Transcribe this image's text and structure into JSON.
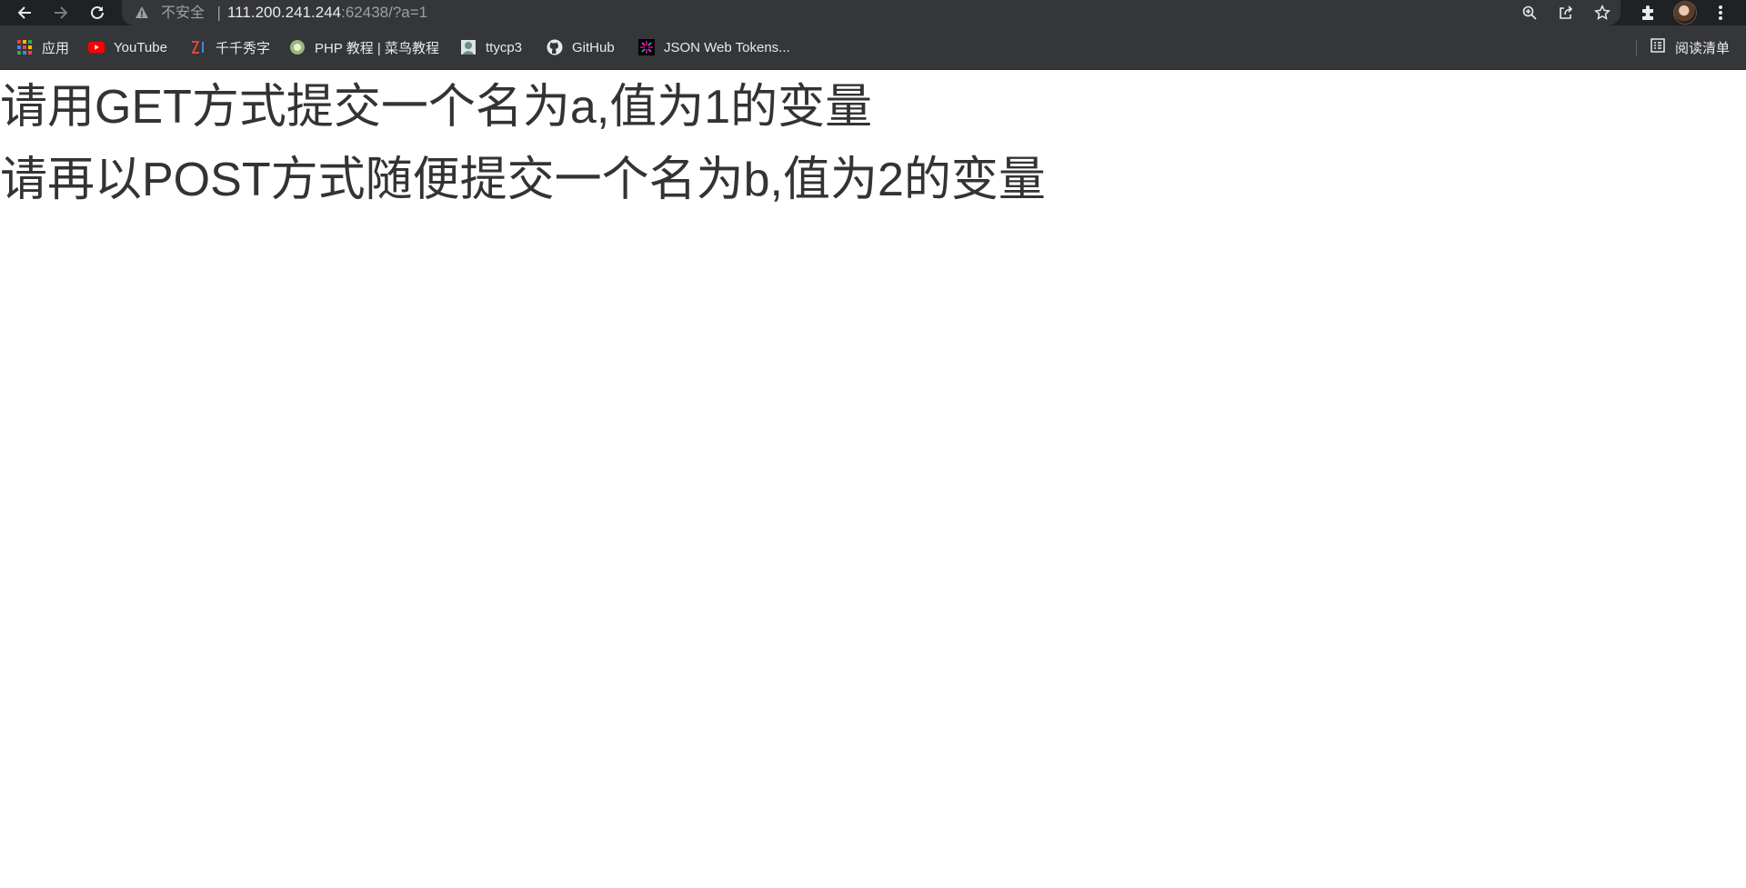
{
  "toolbar": {
    "security_label": "不安全",
    "separator": "|",
    "url_host": "111.200.241.244",
    "url_rest": ":62438/?a=1",
    "icons": [
      "back-icon",
      "forward-icon",
      "reload-icon",
      "warning-icon",
      "zoom-icon",
      "share-icon",
      "star-icon",
      "extensions-icon",
      "avatar",
      "menu-icon"
    ]
  },
  "bookmarks": {
    "items": [
      {
        "label": "应用",
        "icon": "apps-grid-icon"
      },
      {
        "label": "YouTube",
        "icon": "youtube-icon"
      },
      {
        "label": "千千秀字",
        "icon": "qianqian-icon"
      },
      {
        "label": "PHP 教程 | 菜鸟教程",
        "icon": "runoob-icon"
      },
      {
        "label": "ttycp3",
        "icon": "ttycp3-icon"
      },
      {
        "label": "GitHub",
        "icon": "github-icon"
      },
      {
        "label": "JSON Web Tokens...",
        "icon": "jwt-icon"
      }
    ],
    "reading_list": "阅读清单"
  },
  "content": {
    "line1": "请用GET方式提交一个名为a,值为1的变量",
    "line2": "请再以POST方式随便提交一个名为b,值为2的变量"
  },
  "colors": {
    "toolbar_bg": "#202124",
    "bookmarks_bg": "#35363a",
    "text": "#333333"
  }
}
